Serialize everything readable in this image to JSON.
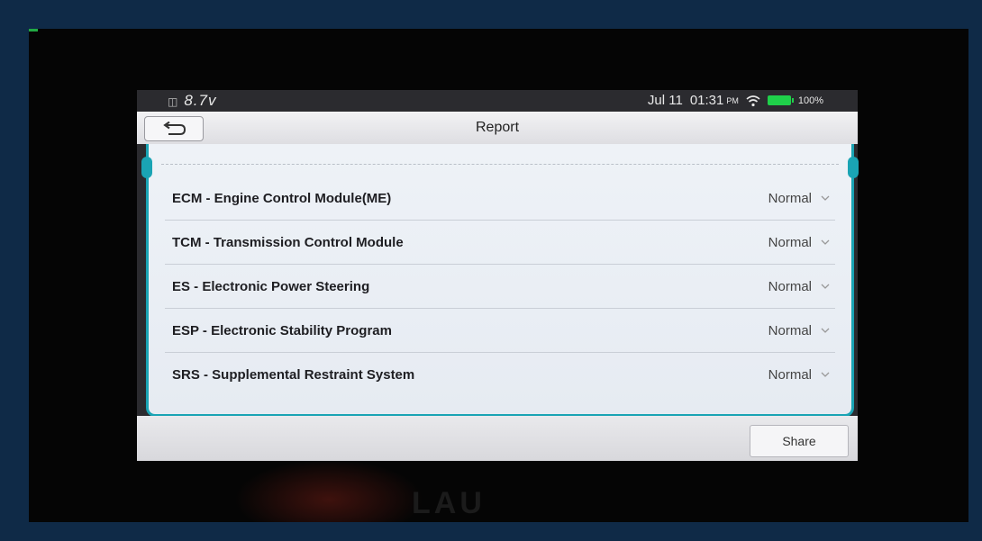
{
  "device": {
    "battery_voltage": "8.7v",
    "date": "Jul 11",
    "time": "01:31",
    "ampm": "PM",
    "battery_percent": "100%",
    "battery_color": "#1fd04a",
    "reflection_text": "LAU"
  },
  "header": {
    "title": "Report",
    "back_icon": "back-arrow-icon"
  },
  "report": {
    "rows": [
      {
        "module": "ECM - Engine Control Module(ME)",
        "status": "Normal"
      },
      {
        "module": "TCM - Transmission Control Module",
        "status": "Normal"
      },
      {
        "module": "ES - Electronic Power Steering",
        "status": "Normal"
      },
      {
        "module": "ESP - Electronic Stability Program",
        "status": "Normal"
      },
      {
        "module": "SRS - Supplemental Restraint System",
        "status": "Normal"
      }
    ]
  },
  "footer": {
    "share_label": "Share"
  },
  "colors": {
    "accent": "#1aa4b4",
    "background": "#0f2a47"
  }
}
